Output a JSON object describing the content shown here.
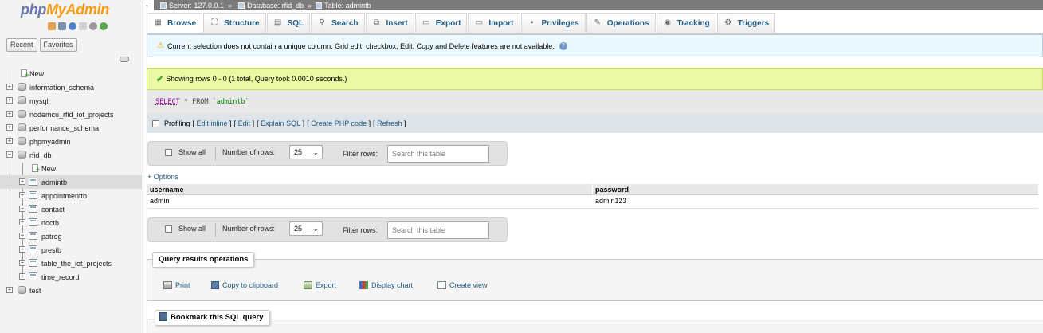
{
  "app": {
    "logo_php": "php",
    "logo_myadmin": "MyAdmin"
  },
  "nav": {
    "tabs": [
      "Recent",
      "Favorites"
    ],
    "tree": [
      {
        "label": "New",
        "type": "new",
        "level": 0
      },
      {
        "label": "information_schema",
        "type": "db",
        "level": 0
      },
      {
        "label": "mysql",
        "type": "db",
        "level": 0
      },
      {
        "label": "nodemcu_rfid_iot_projects",
        "type": "db",
        "level": 0
      },
      {
        "label": "performance_schema",
        "type": "db",
        "level": 0
      },
      {
        "label": "phpmyadmin",
        "type": "db",
        "level": 0
      },
      {
        "label": "rfid_db",
        "type": "db",
        "level": 0,
        "expanded": true
      },
      {
        "label": "New",
        "type": "new",
        "level": 1
      },
      {
        "label": "admintb",
        "type": "table",
        "level": 1,
        "selected": true
      },
      {
        "label": "appointmenttb",
        "type": "table",
        "level": 1
      },
      {
        "label": "contact",
        "type": "table",
        "level": 1
      },
      {
        "label": "doctb",
        "type": "table",
        "level": 1
      },
      {
        "label": "patreg",
        "type": "table",
        "level": 1
      },
      {
        "label": "prestb",
        "type": "table",
        "level": 1
      },
      {
        "label": "table_the_iot_projects",
        "type": "table",
        "level": 1
      },
      {
        "label": "time_record",
        "type": "table",
        "level": 1
      },
      {
        "label": "test",
        "type": "db",
        "level": 0
      }
    ]
  },
  "breadcrumb": {
    "server": "Server: 127.0.0.1",
    "database": "Database: rfid_db",
    "table": "Table: admintb",
    "separator": "»"
  },
  "tabs": [
    {
      "label": "Browse",
      "icon": "browse-icon",
      "active": true
    },
    {
      "label": "Structure",
      "icon": "structure-icon"
    },
    {
      "label": "SQL",
      "icon": "sql-icon"
    },
    {
      "label": "Search",
      "icon": "search-icon"
    },
    {
      "label": "Insert",
      "icon": "insert-icon"
    },
    {
      "label": "Export",
      "icon": "export-icon"
    },
    {
      "label": "Import",
      "icon": "import-icon"
    },
    {
      "label": "Privileges",
      "icon": "privileges-icon"
    },
    {
      "label": "Operations",
      "icon": "wrench-icon"
    },
    {
      "label": "Tracking",
      "icon": "eye-icon"
    },
    {
      "label": "Triggers",
      "icon": "triggers-icon"
    }
  ],
  "notice": {
    "text": "Current selection does not contain a unique column. Grid edit, checkbox, Edit, Copy and Delete features are not available."
  },
  "success": {
    "text": "Showing rows 0 - 0 (1 total, Query took 0.0010 seconds.)"
  },
  "sql": {
    "select": "SELECT",
    "rest": " * FROM ",
    "table": "`admintb`"
  },
  "profiling": {
    "label": "Profiling",
    "links": [
      "Edit inline",
      "Edit",
      "Explain SQL",
      "Create PHP code",
      "Refresh"
    ]
  },
  "navbar": {
    "show_all": "Show all",
    "rows_label": "Number of rows:",
    "rows_value": "25",
    "filter_label": "Filter rows:",
    "filter_placeholder": "Search this table"
  },
  "results": {
    "options": "+ Options",
    "columns": [
      "username",
      "password"
    ],
    "rows": [
      [
        "admin",
        "admin123"
      ]
    ]
  },
  "query_ops": {
    "legend": "Query results operations",
    "items": [
      {
        "label": "Print",
        "icon": "print-icon"
      },
      {
        "label": "Copy to clipboard",
        "icon": "copy-icon"
      },
      {
        "label": "Export",
        "icon": "export-icon"
      },
      {
        "label": "Display chart",
        "icon": "chart-icon"
      },
      {
        "label": "Create view",
        "icon": "view-icon"
      }
    ]
  },
  "bookmark": {
    "legend": "Bookmark this SQL query"
  },
  "colors": {
    "link": "#235a81",
    "success_bg": "#ebf8a4",
    "notice_bg": "#ebf8fd"
  }
}
